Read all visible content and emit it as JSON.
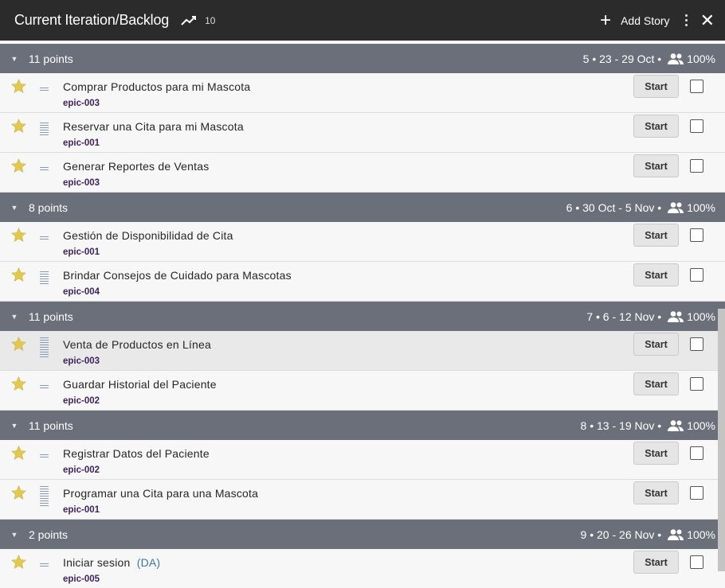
{
  "header": {
    "title": "Current Iteration/Backlog",
    "velocity": "10",
    "add_story_label": "Add Story",
    "icons": {
      "velocity": "trend-icon",
      "add": "plus-icon",
      "menu": "kebab-menu-icon",
      "close": "close-icon"
    }
  },
  "colors": {
    "topbar": "#2b2b2b",
    "iteration_header": "#6b6f7a",
    "epic_label": "#40235e",
    "star": "#e3c84f"
  },
  "start_label": "Start",
  "iterations": [
    {
      "points": "11 points",
      "meta": "5 • 23 - 29 Oct •",
      "percent": "100%",
      "stories": [
        {
          "name": "Comprar Productos para mi Mascota",
          "epic": "epic-003"
        },
        {
          "name": "Reservar una Cita para mi Mascota",
          "epic": "epic-001"
        },
        {
          "name": "Generar Reportes de Ventas",
          "epic": "epic-003"
        }
      ]
    },
    {
      "points": "8 points",
      "meta": "6 • 30 Oct - 5 Nov •",
      "percent": "100%",
      "stories": [
        {
          "name": "Gestión de Disponibilidad de Cita",
          "epic": "epic-001"
        },
        {
          "name": "Brindar Consejos de Cuidado para Mascotas",
          "epic": "epic-004"
        }
      ]
    },
    {
      "points": "11 points",
      "meta": "7 • 6 - 12 Nov •",
      "percent": "100%",
      "stories": [
        {
          "name": "Venta de Productos en Línea",
          "epic": "epic-003"
        },
        {
          "name": "Guardar Historial del Paciente",
          "epic": "epic-002"
        }
      ]
    },
    {
      "points": "11 points",
      "meta": "8 • 13 - 19 Nov •",
      "percent": "100%",
      "stories": [
        {
          "name": "Registrar Datos del Paciente",
          "epic": "epic-002"
        },
        {
          "name": "Programar una Cita para una Mascota",
          "epic": "epic-001"
        }
      ]
    },
    {
      "points": "2 points",
      "meta": "9 • 20 - 26 Nov •",
      "percent": "100%",
      "stories": [
        {
          "name": "Iniciar sesion",
          "label": "(DA)",
          "epic": "epic-005"
        }
      ]
    }
  ]
}
